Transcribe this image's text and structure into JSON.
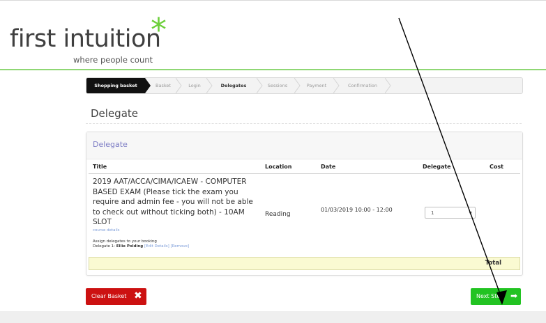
{
  "logo": {
    "brand": "first intuition",
    "star": "*",
    "tagline": "where people count",
    "star_color": "#6ccf3a"
  },
  "steps": [
    {
      "label": "Shopping basket",
      "state": "active"
    },
    {
      "label": "Basket",
      "state": "inactive"
    },
    {
      "label": "Login",
      "state": "inactive"
    },
    {
      "label": "Delegates",
      "state": "current"
    },
    {
      "label": "Sessions",
      "state": "inactive"
    },
    {
      "label": "Payment",
      "state": "inactive"
    },
    {
      "label": "Confirmation",
      "state": "inactive"
    }
  ],
  "page": {
    "title": "Delegate"
  },
  "panel": {
    "title": "Delegate",
    "columns": {
      "title": "Title",
      "location": "Location",
      "date": "Date",
      "delegate": "Delegate",
      "cost": "Cost"
    },
    "row": {
      "title": "2019 AAT/ACCA/CIMA/ICAEW - COMPUTER BASED EXAM (Please tick the exam you require and admin fee - you will not be able to check out without ticking both) - 10AM SLOT",
      "course_details": "course details",
      "assign_text": "Assign delegates to your booking",
      "delegate_prefix": "Delegate 1:",
      "delegate_name": "Ellie Polding",
      "edit_link": "[Edit Details]",
      "remove_link": "[Remove]",
      "location": "Reading",
      "date": "01/03/2019 10:00 - 12:00",
      "delegate_qty": "1"
    },
    "total_label": "Total"
  },
  "buttons": {
    "clear_basket": "Clear Basket",
    "next_step": "Next Step"
  },
  "colors": {
    "accent_green": "#22c322",
    "danger_red": "#cc1111",
    "panel_title": "#7b7bc4"
  }
}
